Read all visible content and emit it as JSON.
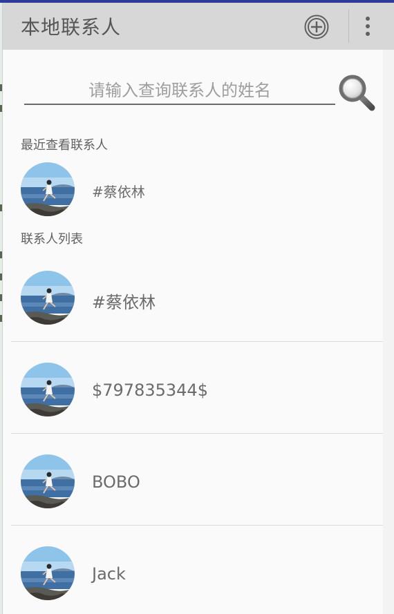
{
  "appbar": {
    "title": "本地联系人",
    "background": "#d7d7d7"
  },
  "icons": {
    "add": "add-circle-icon",
    "more": "more-vert-icon",
    "search": "magnifier-icon",
    "avatar": "avatar-photo-icon"
  },
  "search": {
    "placeholder": "请输入查询联系人的姓名",
    "value": ""
  },
  "recent": {
    "label": "最近查看联系人",
    "items": [
      {
        "name": "#蔡依林"
      }
    ]
  },
  "contacts": {
    "label": "联系人列表",
    "items": [
      {
        "name": "#蔡依林"
      },
      {
        "name": "$797835344$"
      },
      {
        "name": "BOBO"
      },
      {
        "name": "Jack"
      }
    ]
  }
}
